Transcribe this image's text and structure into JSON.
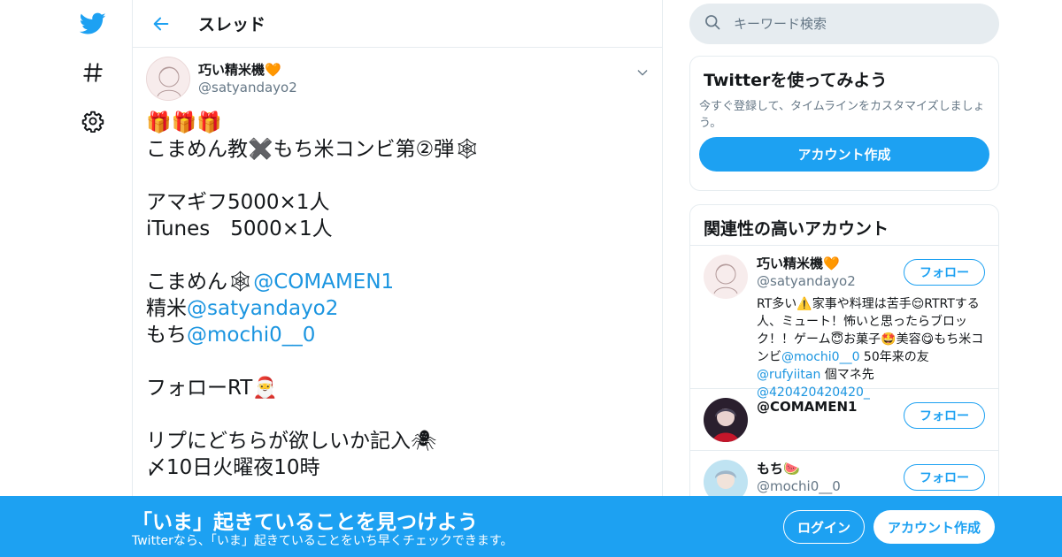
{
  "colors": {
    "accent": "#1da1f2",
    "link": "#1b95e0",
    "muted": "#657786",
    "border": "#e6ecf0"
  },
  "nav": {
    "items": [
      {
        "icon": "twitter-bird-icon"
      },
      {
        "icon": "hashtag-icon"
      },
      {
        "icon": "gear-icon"
      }
    ]
  },
  "header": {
    "title": "スレッド",
    "back_icon": "arrow-left-icon"
  },
  "tweet": {
    "author_name": "巧い精米機🧡",
    "author_handle": "@satyandayo2",
    "menu_icon": "chevron-down-icon",
    "lines": {
      "l1": "🎁🎁🎁",
      "l2": "こまめん教✖️もち米コンビ第②弾🕸",
      "l3": "アマギフ5000×1人",
      "l4": "iTunes　5000×1人",
      "l5_prefix": "こまめん🕸",
      "l5_mention": "@COMAMEN1",
      "l6_prefix": "精米",
      "l6_mention": "@satyandayo2",
      "l7_prefix": "もち",
      "l7_mention": "@mochi0__0",
      "l8": "フォローRT🎅",
      "l9": "リプにどちらが欲しいか記入🕷",
      "l10": "〆10日火曜夜10時"
    }
  },
  "search": {
    "placeholder": "キーワード検索",
    "icon": "search-icon"
  },
  "signup_card": {
    "title": "Twitterを使ってみよう",
    "desc": "今すぐ登録して、タイムラインをカスタマイズしましょう。",
    "button": "アカウント作成"
  },
  "related": {
    "title": "関連性の高いアカウント",
    "follow_label": "フォロー",
    "accounts": [
      {
        "name": "巧い精米機🧡",
        "handle": "@satyandayo2",
        "bio_parts": {
          "p1": "RT多い⚠️家事や料理は苦手😌RTRTする人、ミュート！怖いと思ったらブロック！！ゲーム😇お菓子🤩美容😋もち米コンビ",
          "m1": "@mochi0__0",
          "p2": " 50年来の友 ",
          "m2": "@rufyiitan",
          "p3": " 個マネ先",
          "m3": "@420420420420_"
        }
      },
      {
        "name": "@COMAMEN1",
        "handle": ""
      },
      {
        "name": "もち🍉",
        "handle": "@mochi0__0"
      }
    ]
  },
  "bottom_bar": {
    "title": "「いま」起きていることを見つけよう",
    "subtitle": "Twitterなら、「いま」起きていることをいち早くチェックできます。",
    "login": "ログイン",
    "signup": "アカウント作成"
  }
}
